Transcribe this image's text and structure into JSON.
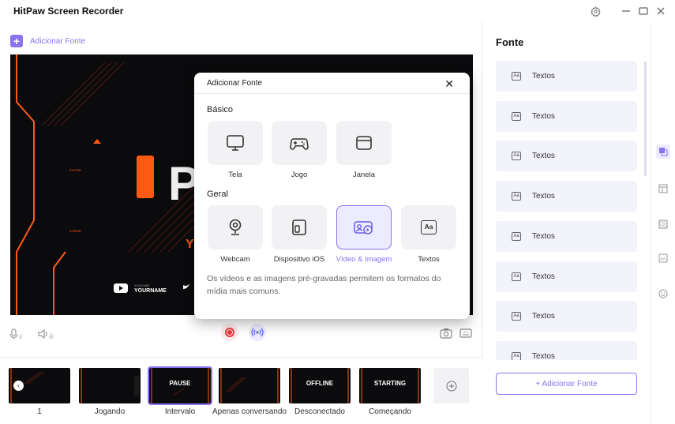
{
  "app": {
    "title": "HitPaw Screen Recorder"
  },
  "toolbar": {
    "add_source_label": "Adicionar Fonte"
  },
  "preview": {
    "big_text": "P",
    "yourname_label": "YOURNAME",
    "youtube_small": "YOUTUBE",
    "accent_color": "#ff5a14"
  },
  "scenes": [
    {
      "label": "1",
      "text": ""
    },
    {
      "label": "Jogando",
      "text": ""
    },
    {
      "label": "Intervalo",
      "text": "PAUSE"
    },
    {
      "label": "Apenas conversando",
      "text": ""
    },
    {
      "label": "Desconectado",
      "text": "OFFLINE"
    },
    {
      "label": "Começando",
      "text": "STARTING"
    }
  ],
  "side": {
    "title": "Fonte",
    "items": [
      "Textos",
      "Textos",
      "Textos",
      "Textos",
      "Textos",
      "Textos",
      "Textos",
      "Textos"
    ],
    "item_icon_text": "Aa",
    "add_button": "+ Adicionar Fonte"
  },
  "modal": {
    "title": "Adicionar Fonte",
    "section_basic": "Básico",
    "section_general": "Geral",
    "basic": [
      {
        "label": "Tela",
        "icon": "monitor-icon"
      },
      {
        "label": "Jogo",
        "icon": "gamepad-icon"
      },
      {
        "label": "Janela",
        "icon": "window-icon"
      }
    ],
    "general": [
      {
        "label": "Webcam",
        "icon": "webcam-icon"
      },
      {
        "label": "Dispositivo iOS",
        "icon": "ios-device-icon"
      },
      {
        "label": "Vídeo & Imagem",
        "icon": "video-image-icon"
      },
      {
        "label": "Textos",
        "icon": "text-icon"
      }
    ],
    "selected": "Vídeo & Imagem",
    "description": "Os vídeos e as imagens pré-gravadas permitem os formatos do mídia mais comuns.",
    "text_icon_glyph": "Aa"
  },
  "colors": {
    "accent": "#8a72f0",
    "record": "#e8383d"
  }
}
